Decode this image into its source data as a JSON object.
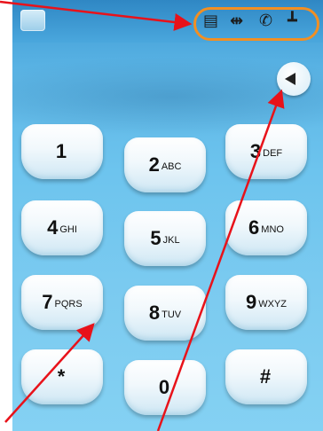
{
  "statusbar": {
    "icons": [
      "sim-icon",
      "usb-icon",
      "handset-icon",
      "network-icon"
    ],
    "icon_glyphs": [
      "▤",
      "⇹",
      "✆",
      "┻"
    ]
  },
  "dialpad": {
    "keys": [
      {
        "digit": "1",
        "letters": ""
      },
      {
        "digit": "2",
        "letters": "ABC"
      },
      {
        "digit": "3",
        "letters": "DEF"
      },
      {
        "digit": "4",
        "letters": "GHI"
      },
      {
        "digit": "5",
        "letters": "JKL"
      },
      {
        "digit": "6",
        "letters": "MNO"
      },
      {
        "digit": "7",
        "letters": "PQRS"
      },
      {
        "digit": "8",
        "letters": "TUV"
      },
      {
        "digit": "9",
        "letters": "WXYZ"
      },
      {
        "digit": "*",
        "letters": ""
      },
      {
        "digit": "0",
        "letters": ""
      },
      {
        "digit": "#",
        "letters": ""
      }
    ]
  },
  "colors": {
    "annotation": "#e8121a",
    "highlight_ring": "#f28f22"
  }
}
